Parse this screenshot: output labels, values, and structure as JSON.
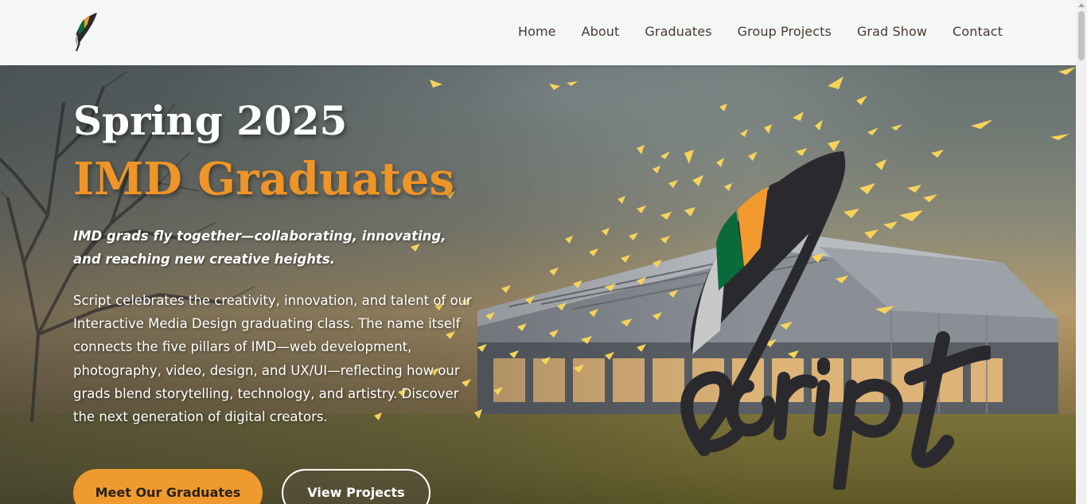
{
  "nav": {
    "logo_icon": "quill-feather-icon",
    "links": [
      {
        "label": "Home"
      },
      {
        "label": "About"
      },
      {
        "label": "Graduates"
      },
      {
        "label": "Group Projects"
      },
      {
        "label": "Grad Show"
      },
      {
        "label": "Contact"
      }
    ]
  },
  "hero": {
    "title_line1": "Spring 2025",
    "title_line2": "IMD Graduates",
    "tagline": "IMD grads fly together—collaborating, innovating, and reaching new creative heights.",
    "body": "Script celebrates the creativity, innovation, and talent of our Interactive Media Design graduating class. The name itself connects the five pillars of IMD—web development, photography, video, design, and UX/UI—reflecting how our grads blend storytelling, technology, and artistry. Discover the next generation of digital creators.",
    "primary_button": "Meet Our Graduates",
    "secondary_button": "View Projects",
    "hero_logo_icon": "script-quill-logo-icon"
  },
  "colors": {
    "accent_orange": "#ef9427",
    "nav_text": "#4a3a30",
    "quill_green": "#0a6a3a",
    "quill_orange": "#f29a2e",
    "logo_dark": "#2a2a2e"
  }
}
